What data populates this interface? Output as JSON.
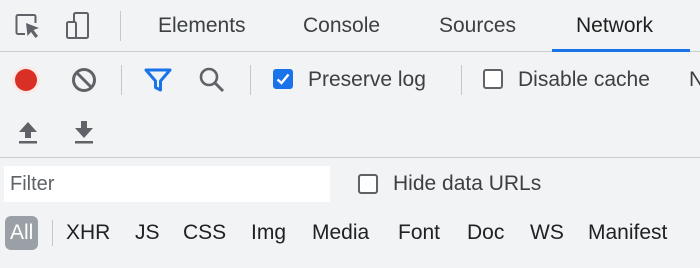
{
  "tabs": [
    {
      "label": "Elements"
    },
    {
      "label": "Console"
    },
    {
      "label": "Sources"
    },
    {
      "label": "Network"
    }
  ],
  "active_tab": "Network",
  "toolbar": {
    "preserve_log": {
      "label": "Preserve log",
      "checked": true
    },
    "disable_cache": {
      "label": "Disable cache",
      "checked": false
    },
    "overflow_label": "N"
  },
  "filter": {
    "placeholder": "Filter",
    "value": "",
    "hide_data_urls": {
      "label": "Hide data URLs",
      "checked": false
    }
  },
  "type_filters": [
    {
      "label": "All",
      "active": true
    },
    {
      "label": "XHR"
    },
    {
      "label": "JS"
    },
    {
      "label": "CSS"
    },
    {
      "label": "Img"
    },
    {
      "label": "Media"
    },
    {
      "label": "Font"
    },
    {
      "label": "Doc"
    },
    {
      "label": "WS"
    },
    {
      "label": "Manifest"
    }
  ],
  "colors": {
    "accent": "#1a73e8",
    "record": "#d93025",
    "background": "#f1f3f4"
  },
  "icons": {
    "select_element": "cursor-select-icon",
    "device_toolbar": "device-toggle-icon",
    "record": "record-icon",
    "clear": "clear-icon",
    "filter": "filter-icon",
    "search": "search-icon",
    "import": "upload-icon",
    "export": "download-icon"
  }
}
